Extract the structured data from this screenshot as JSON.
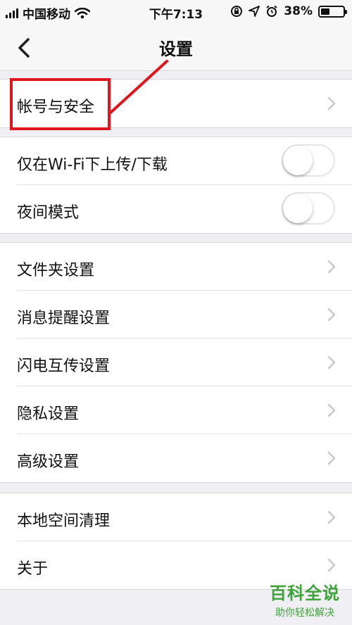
{
  "status_bar": {
    "carrier": "中国移动",
    "time": "下午7:13",
    "battery": "38%",
    "battery_level": 0.38
  },
  "nav": {
    "title": "设置"
  },
  "groups": [
    {
      "items": [
        {
          "label": "帐号与安全"
        }
      ]
    },
    {
      "items": [
        {
          "label": "仅在Wi-Fi下上传/下载",
          "toggle_on": false
        },
        {
          "label": "夜间模式",
          "toggle_on": false
        }
      ]
    },
    {
      "items": [
        {
          "label": "文件夹设置"
        },
        {
          "label": "消息提醒设置"
        },
        {
          "label": "闪电互传设置"
        },
        {
          "label": "隐私设置"
        },
        {
          "label": "高级设置"
        }
      ]
    },
    {
      "items": [
        {
          "label": "本地空间清理"
        },
        {
          "label": "关于"
        }
      ]
    }
  ],
  "watermark": {
    "title": "百科全说",
    "subtitle": "助你轻松解决"
  },
  "colors": {
    "annotation": "#e0161f",
    "watermark": "#3ea33a",
    "chevron": "#c7c7cc"
  }
}
